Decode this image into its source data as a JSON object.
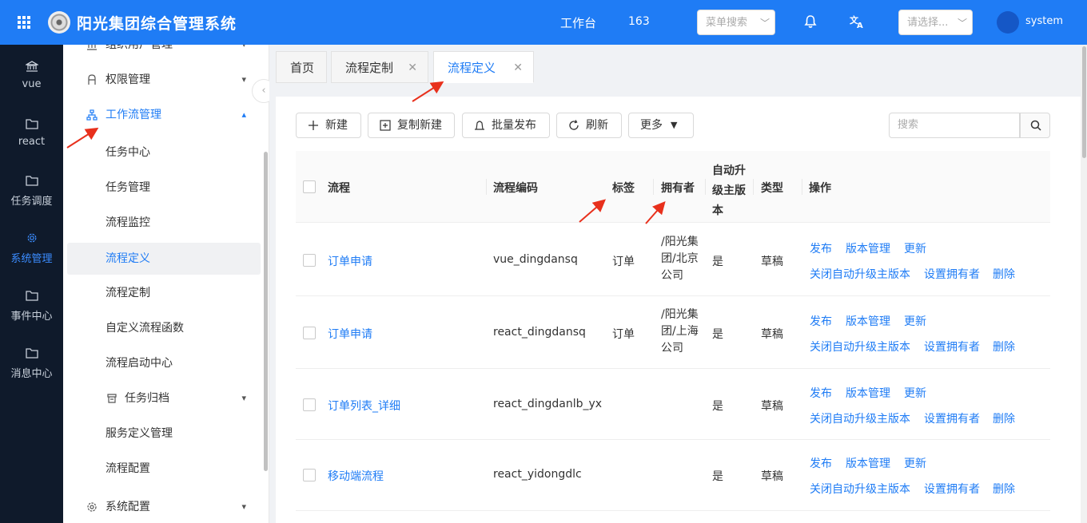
{
  "header": {
    "app_title": "阳光集团综合管理系统",
    "workbench": "工作台",
    "count": "163",
    "menu_search_placeholder": "菜单搜索",
    "select_placeholder": "请选择...",
    "user_name": "system"
  },
  "rail": [
    {
      "label": "vue",
      "icon": "bank-icon"
    },
    {
      "label": "react",
      "icon": "folder-icon"
    },
    {
      "label": "任务调度",
      "icon": "folder-icon"
    },
    {
      "label": "系统管理",
      "icon": "gear-icon",
      "active": true
    },
    {
      "label": "事件中心",
      "icon": "folder-icon"
    },
    {
      "label": "消息中心",
      "icon": "folder-icon"
    }
  ],
  "sidebar": {
    "items": [
      {
        "label": "组织用户管理"
      },
      {
        "label": "权限管理"
      },
      {
        "label": "工作流管理"
      },
      {
        "label": "任务中心"
      },
      {
        "label": "任务管理"
      },
      {
        "label": "流程监控"
      },
      {
        "label": "流程定义"
      },
      {
        "label": "流程定制"
      },
      {
        "label": "自定义流程函数"
      },
      {
        "label": "流程启动中心"
      },
      {
        "label": "任务归档"
      },
      {
        "label": "服务定义管理"
      },
      {
        "label": "流程配置"
      },
      {
        "label": "系统配置"
      }
    ]
  },
  "tabs": [
    {
      "label": "首页"
    },
    {
      "label": "流程定制"
    },
    {
      "label": "流程定义"
    }
  ],
  "toolbar": {
    "new": "新建",
    "copy_new": "复制新建",
    "batch_publish": "批量发布",
    "refresh": "刷新",
    "more": "更多",
    "search_placeholder": "搜索"
  },
  "table": {
    "columns": {
      "process": "流程",
      "code": "流程编码",
      "tag": "标签",
      "owner": "拥有者",
      "auto_upgrade": "自动升级主版本",
      "type": "类型",
      "actions": "操作"
    },
    "rows": [
      {
        "process": "订单申请",
        "code": "vue_dingdansq",
        "tag": "订单",
        "owner": "/阳光集团/北京公司",
        "auto_upgrade": "是",
        "type": "草稿"
      },
      {
        "process": "订单申请",
        "code": "react_dingdansq",
        "tag": "订单",
        "owner": "/阳光集团/上海公司",
        "auto_upgrade": "是",
        "type": "草稿"
      },
      {
        "process": "订单列表_详细",
        "code": "react_dingdanlb_yx",
        "tag": "",
        "owner": "",
        "auto_upgrade": "是",
        "type": "草稿"
      },
      {
        "process": "移动端流程",
        "code": "react_yidongdlc",
        "tag": "",
        "owner": "",
        "auto_upgrade": "是",
        "type": "草稿"
      }
    ],
    "actions": {
      "publish": "发布",
      "version_mgmt": "版本管理",
      "update": "更新",
      "close_auto_upgrade": "关闭自动升级主版本",
      "set_owner": "设置拥有者",
      "delete": "删除"
    }
  },
  "colors": {
    "primary": "#1f7cf5",
    "rail_bg": "#0f1a2b",
    "annotation": "#e8301c"
  }
}
